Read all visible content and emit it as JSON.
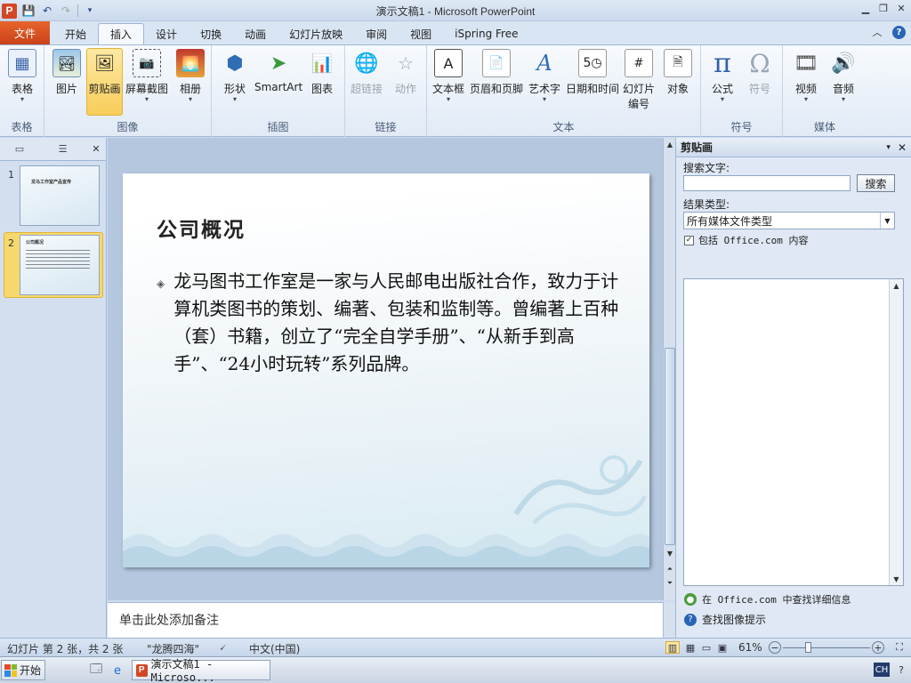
{
  "window": {
    "title": "演示文稿1 - Microsoft PowerPoint",
    "logo_letter": "P"
  },
  "tabs": [
    {
      "label": "文件"
    },
    {
      "label": "开始"
    },
    {
      "label": "插入"
    },
    {
      "label": "设计"
    },
    {
      "label": "切换"
    },
    {
      "label": "动画"
    },
    {
      "label": "幻灯片放映"
    },
    {
      "label": "审阅"
    },
    {
      "label": "视图"
    },
    {
      "label": "iSpring Free"
    }
  ],
  "active_tab": "插入",
  "ribbon": {
    "groups": [
      {
        "label": "表格",
        "buttons": [
          {
            "label": "表格",
            "icon": "table-icon"
          }
        ]
      },
      {
        "label": "图像",
        "buttons": [
          {
            "label": "图片",
            "icon": "picture-icon"
          },
          {
            "label": "剪贴画",
            "icon": "clipart-icon"
          },
          {
            "label": "屏幕截图",
            "icon": "screenshot-icon"
          },
          {
            "label": "相册",
            "icon": "photo-album-icon"
          }
        ]
      },
      {
        "label": "插图",
        "buttons": [
          {
            "label": "形状",
            "icon": "shapes-icon"
          },
          {
            "label": "SmartArt",
            "icon": "smartart-icon"
          },
          {
            "label": "图表",
            "icon": "chart-icon"
          }
        ]
      },
      {
        "label": "链接",
        "buttons": [
          {
            "label": "超链接",
            "icon": "hyperlink-icon"
          },
          {
            "label": "动作",
            "icon": "action-icon"
          }
        ]
      },
      {
        "label": "文本",
        "buttons": [
          {
            "label": "文本框",
            "icon": "textbox-icon"
          },
          {
            "label": "页眉和页脚",
            "icon": "header-footer-icon"
          },
          {
            "label": "艺术字",
            "icon": "wordart-icon"
          },
          {
            "label": "日期和时间",
            "icon": "date-time-icon"
          },
          {
            "label": "幻灯片",
            "label2": "编号",
            "icon": "slide-number-icon"
          },
          {
            "label": "对象",
            "icon": "object-icon"
          }
        ]
      },
      {
        "label": "符号",
        "buttons": [
          {
            "label": "公式",
            "icon": "equation-icon"
          },
          {
            "label": "符号",
            "icon": "symbol-icon"
          }
        ]
      },
      {
        "label": "媒体",
        "buttons": [
          {
            "label": "视频",
            "icon": "video-icon"
          },
          {
            "label": "音频",
            "icon": "audio-icon"
          }
        ]
      }
    ]
  },
  "thumbnails": [
    {
      "number": "1",
      "title": "龙马工作室产品宣传"
    },
    {
      "number": "2",
      "title": "公司概况"
    }
  ],
  "slide": {
    "title": "公司概况",
    "body": "龙马图书工作室是一家与人民邮电出版社合作，致力于计算机类图书的策划、编著、包装和监制等。曾编著上百种（套）书籍，创立了“完全自学手册”、“从新手到高手”、“24小时玩转”系列品牌。"
  },
  "notes": {
    "placeholder": "单击此处添加备注"
  },
  "clipart_pane": {
    "title": "剪贴画",
    "search_label": "搜索文字:",
    "search_value": "",
    "search_button": "搜索",
    "result_type_label": "结果类型:",
    "result_type_value": "所有媒体文件类型",
    "include_office_label": "包括 Office.com 内容",
    "include_office_checked": true,
    "link_office": "在 Office.com 中查找详细信息",
    "link_tips": "查找图像提示"
  },
  "statusbar": {
    "slide_info": "幻灯片 第 2 张，共 2 张",
    "theme": "\"龙腾四海\"",
    "language": "中文(中国)",
    "zoom": "61%"
  },
  "taskbar": {
    "start_label": "开始",
    "task_label": "演示文稿1 - Microso...",
    "ime": "CH"
  },
  "colors": {
    "file_tab": "#d24726",
    "active_button": "#f8cd5a",
    "ribbon_bg": "#e1eaf6"
  }
}
